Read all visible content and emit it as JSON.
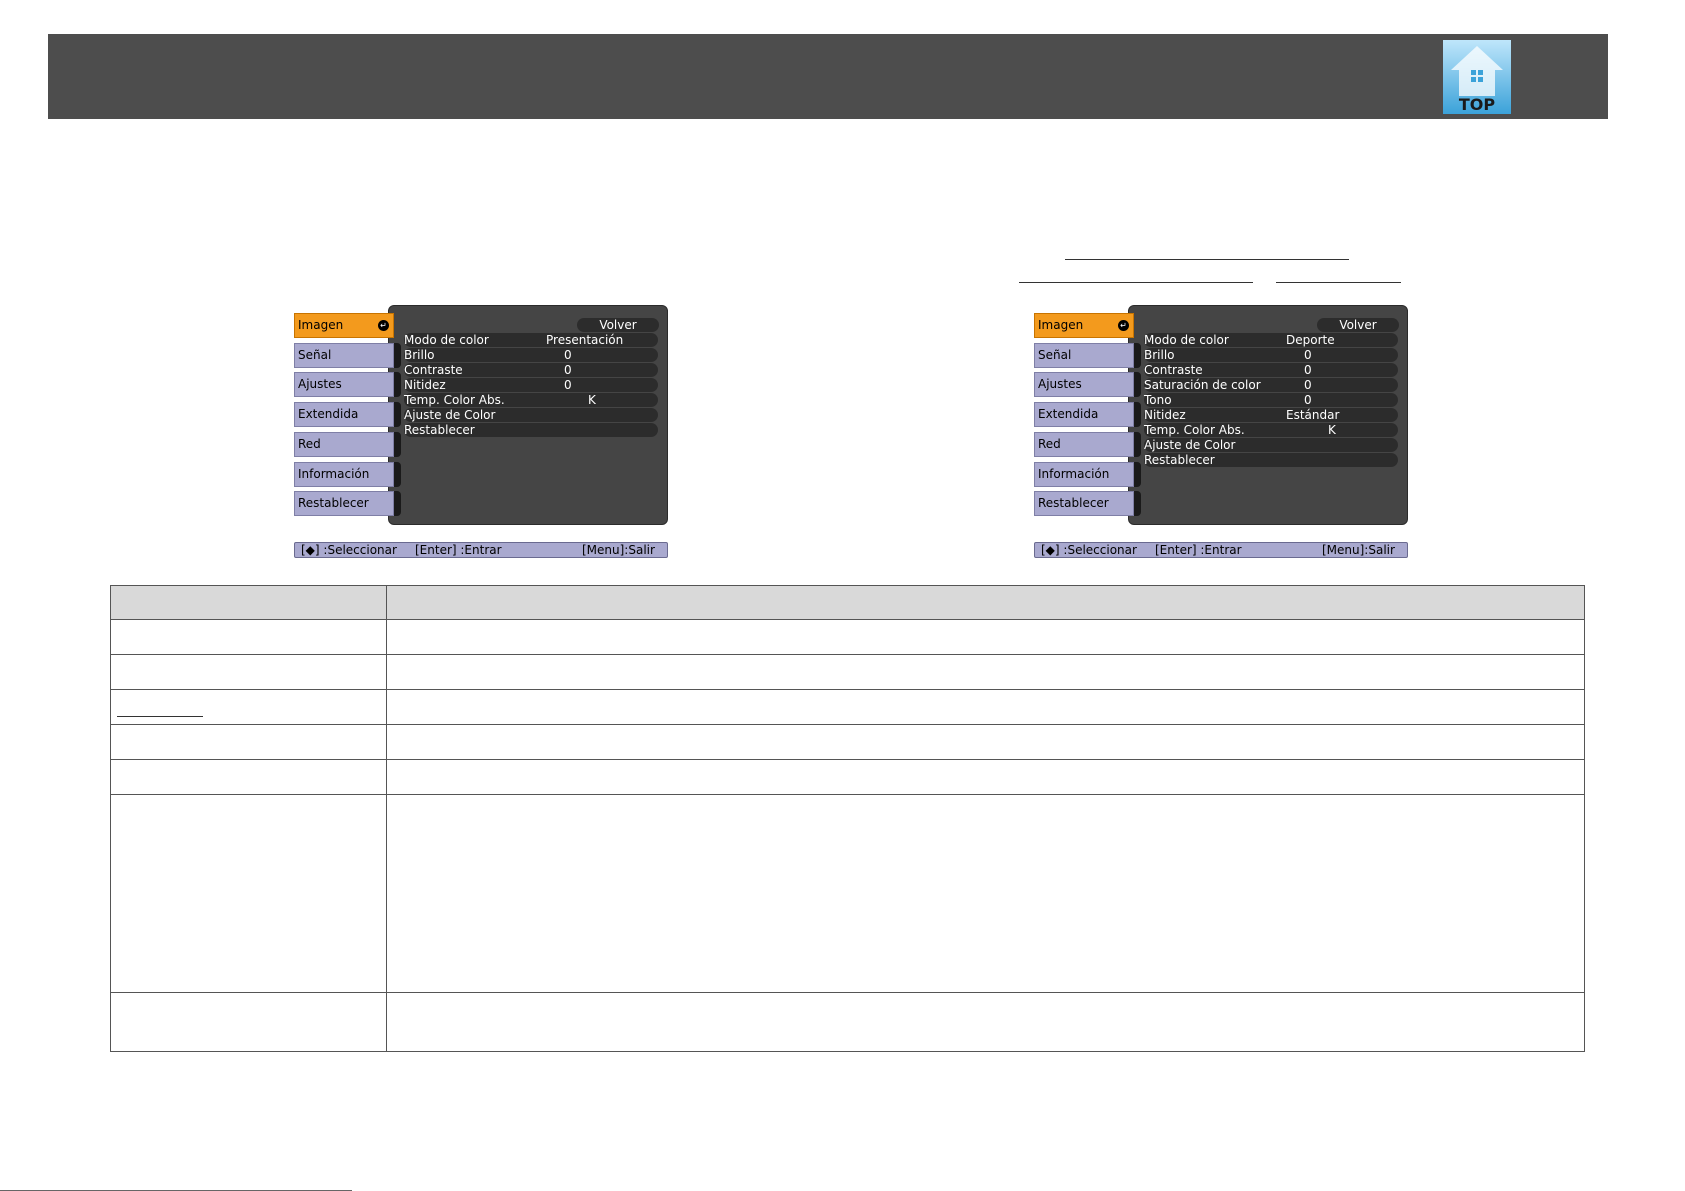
{
  "header": {
    "top_icon_label": "TOP",
    "top_icon_name": "home-top-icon"
  },
  "menus": [
    {
      "tabs": [
        "Imagen",
        "Señal",
        "Ajustes",
        "Extendida",
        "Red",
        "Información",
        "Restablecer"
      ],
      "active_tab": "Imagen",
      "back_label": "Volver",
      "rows": [
        {
          "label": "Modo de color",
          "value": "Presentación"
        },
        {
          "label": "Brillo",
          "value": "0"
        },
        {
          "label": "Contraste",
          "value": "0"
        },
        {
          "label": "Nitidez",
          "value": "0"
        },
        {
          "label": "Temp. Color Abs.",
          "value": "K"
        },
        {
          "label": "Ajuste de Color",
          "value": ""
        },
        {
          "label": "Restablecer",
          "value": ""
        }
      ],
      "status": {
        "select": "[◆] :Seleccionar",
        "enter": "[Enter] :Entrar",
        "exit": "[Menu]:Salir"
      }
    },
    {
      "tabs": [
        "Imagen",
        "Señal",
        "Ajustes",
        "Extendida",
        "Red",
        "Información",
        "Restablecer"
      ],
      "active_tab": "Imagen",
      "back_label": "Volver",
      "rows": [
        {
          "label": "Modo de color",
          "value": "Deporte"
        },
        {
          "label": "Brillo",
          "value": "0"
        },
        {
          "label": "Contraste",
          "value": "0"
        },
        {
          "label": "Saturación de color",
          "value": "0"
        },
        {
          "label": "Tono",
          "value": "0"
        },
        {
          "label": "Nitidez",
          "value": "Estándar"
        },
        {
          "label": "Temp. Color Abs.",
          "value": "K"
        },
        {
          "label": "Ajuste de Color",
          "value": ""
        },
        {
          "label": "Restablecer",
          "value": ""
        }
      ],
      "status": {
        "select": "[◆] :Seleccionar",
        "enter": "[Enter] :Entrar",
        "exit": "[Menu]:Salir"
      }
    }
  ],
  "table": {
    "header": [
      "",
      ""
    ],
    "rows": [
      [
        "",
        ""
      ],
      [
        "",
        ""
      ],
      [
        "",
        ""
      ],
      [
        "",
        ""
      ],
      [
        "",
        ""
      ],
      [
        "",
        ""
      ],
      [
        "",
        ""
      ]
    ]
  }
}
